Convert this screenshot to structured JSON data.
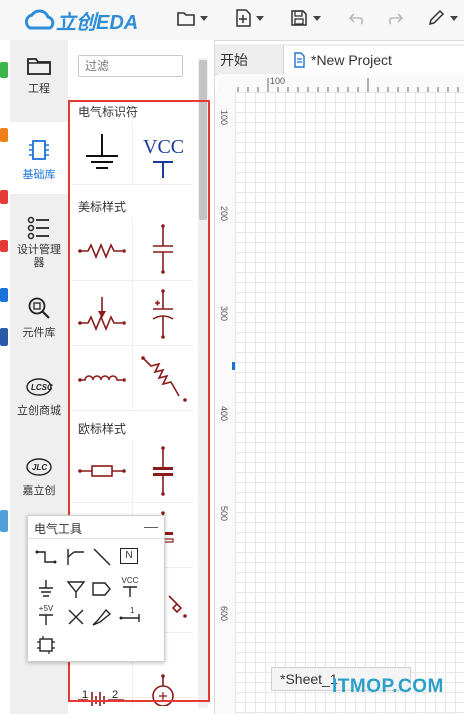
{
  "app": {
    "logo_text": "立创EDA"
  },
  "nav": {
    "items": [
      {
        "label": "工程",
        "icon": "folder-icon"
      },
      {
        "label": "基础库",
        "icon": "chip-icon",
        "active": true
      },
      {
        "label": "设计管理器",
        "icon": "list-tree-icon"
      },
      {
        "label": "元件库",
        "icon": "component-search-icon"
      },
      {
        "label": "立创商城",
        "icon": "lcsc-logo-icon"
      },
      {
        "label": "嘉立创",
        "icon": "jlc-logo-icon"
      }
    ]
  },
  "library": {
    "filter_placeholder": "过滤",
    "sections": [
      {
        "title": "电气标识符"
      },
      {
        "title": "美标样式"
      },
      {
        "title": "欧标样式"
      }
    ],
    "vcc_text": "VCC"
  },
  "tabs": [
    {
      "label": "开始"
    },
    {
      "label": "*New Project"
    }
  ],
  "ruler": {
    "top_tick": "100",
    "left_ticks": [
      "100",
      "200",
      "300",
      "400",
      "500",
      "600"
    ]
  },
  "sheet": {
    "label": "*Sheet_1"
  },
  "watermark": "ITMOP.COM",
  "electrical_tools": {
    "title": "电气工具",
    "minimize_label": "—",
    "net_label_text": "N",
    "vcc_label": "VCC",
    "power_label": "+5V",
    "bus_label": "1"
  },
  "colors": {
    "accent": "#1a73d9",
    "highlight_box": "#e53935",
    "symbol": "#8b1a1a"
  }
}
